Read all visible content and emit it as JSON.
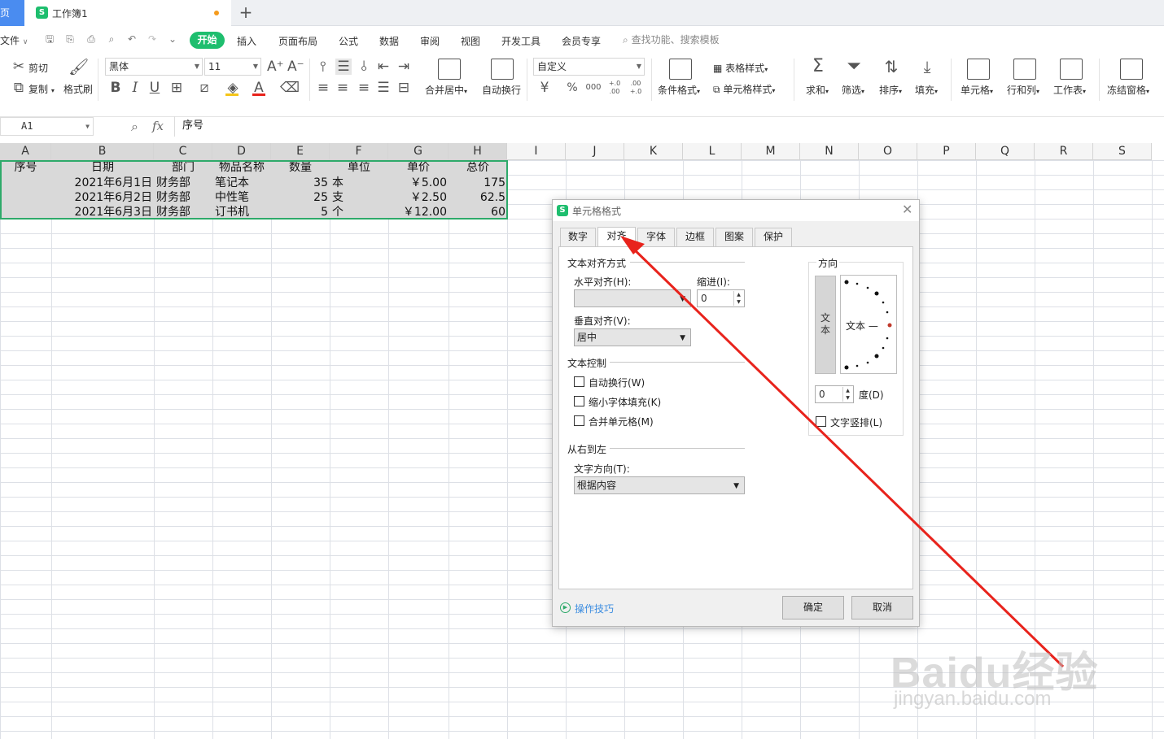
{
  "tabs": {
    "home_fragment": "页",
    "doc_icon": "S",
    "doc_title": "工作簿1",
    "new_tab": "+"
  },
  "menu": {
    "file": "文件",
    "items": [
      "开始",
      "插入",
      "页面布局",
      "公式",
      "数据",
      "审阅",
      "视图",
      "开发工具",
      "会员专享"
    ],
    "search": "查找功能、搜索模板"
  },
  "ribbon": {
    "cut": "剪切",
    "copy": "复制",
    "format_painter": "格式刷",
    "font_name": "黑体",
    "font_size": "11",
    "merge_center": "合并居中",
    "wrap_text": "自动换行",
    "number_format": "自定义",
    "table_style": "表格样式",
    "conditional_format": "条件格式",
    "cell_style": "单元格样式",
    "sum": "求和",
    "filter": "筛选",
    "sort": "排序",
    "fill": "填充",
    "cell": "单元格",
    "row_col": "行和列",
    "worksheet": "工作表",
    "freeze": "冻结窗格",
    "currency": "¥",
    "percent": "%",
    "thousands": "000",
    "inc_decimal": "+.0 .00",
    "dec_decimal": ".00 +.0"
  },
  "formula_bar": {
    "cell_ref": "A1",
    "fx": "fx",
    "content": "序号"
  },
  "sheet": {
    "columns": [
      "A",
      "B",
      "C",
      "D",
      "E",
      "F",
      "G",
      "H",
      "I",
      "J",
      "K",
      "L",
      "M",
      "N",
      "O",
      "P",
      "Q",
      "R",
      "S"
    ],
    "header_row": [
      "序号",
      "日期",
      "部门",
      "物品名称",
      "数量",
      "单位",
      "单价",
      "总价"
    ],
    "rows": [
      [
        "",
        "2021年6月1日",
        "财务部",
        "笔记本",
        "35",
        "本",
        "￥5.00",
        "175"
      ],
      [
        "",
        "2021年6月2日",
        "财务部",
        "中性笔",
        "25",
        "支",
        "￥2.50",
        "62.5"
      ],
      [
        "",
        "2021年6月3日",
        "财务部",
        "订书机",
        "5",
        "个",
        "￥12.00",
        "60"
      ]
    ]
  },
  "dialog": {
    "logo": "S",
    "title": "单元格格式",
    "tabs": [
      "数字",
      "对齐",
      "字体",
      "边框",
      "图案",
      "保护"
    ],
    "active_tab": "对齐",
    "text_align_group": "文本对齐方式",
    "horizontal_label": "水平对齐(H):",
    "horizontal_value": "",
    "indent_label": "缩进(I):",
    "indent_value": "0",
    "vertical_label": "垂直对齐(V):",
    "vertical_value": "居中",
    "text_control_group": "文本控制",
    "wrap_text": "自动换行(W)",
    "shrink_to_fit": "缩小字体填充(K)",
    "merge_cells": "合并单元格(M)",
    "rtl_group": "从右到左",
    "text_direction_label": "文字方向(T):",
    "text_direction_value": "根据内容",
    "orientation_group": "方向",
    "vertical_text": "文本",
    "dial_text": "文本 —",
    "degree_value": "0",
    "degree_label": "度(D)",
    "vertical_stack": "文字竖排(L)",
    "tips": "操作技巧",
    "ok": "确定",
    "cancel": "取消"
  },
  "watermark": {
    "brand": "Baidu经验",
    "url": "jingyan.baidu.com"
  },
  "colors": {
    "accent_green": "#1ebe6e",
    "selection_border": "#2eaa6a",
    "arrow_red": "#e8231c"
  }
}
